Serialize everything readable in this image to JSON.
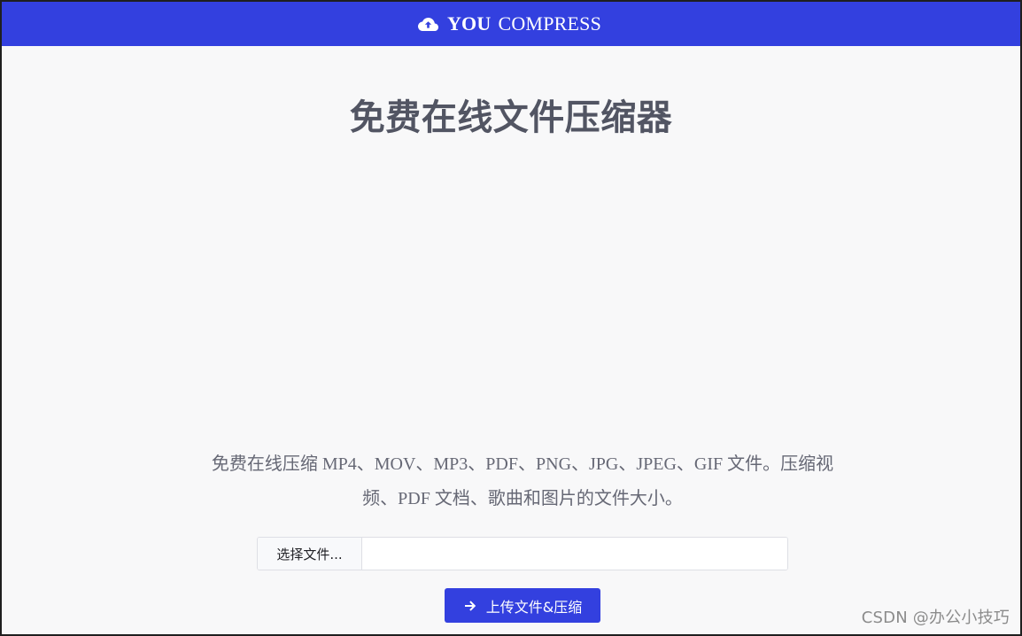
{
  "header": {
    "brand_bold": "YOU",
    "brand_light": "COMPRESS",
    "icon": "cloud-upload-icon"
  },
  "main": {
    "title": "免费在线文件压缩器",
    "description_line1": "免费在线压缩 MP4、MOV、MP3、PDF、PNG、JPG、JPEG、GIF 文件。压缩视",
    "description_line2": "频、PDF 文档、歌曲和图片的文件大小。"
  },
  "file_picker": {
    "button_label": "选择文件...",
    "file_name": ""
  },
  "upload_button": {
    "label": "上传文件&压缩",
    "icon": "arrow-right-icon"
  },
  "watermark": {
    "text": "CSDN @办公小技巧"
  },
  "colors": {
    "primary": "#3340df",
    "page_background": "#f8f8f9",
    "title_text": "#525563",
    "body_text": "#666875",
    "input_border": "#dedfe5"
  }
}
